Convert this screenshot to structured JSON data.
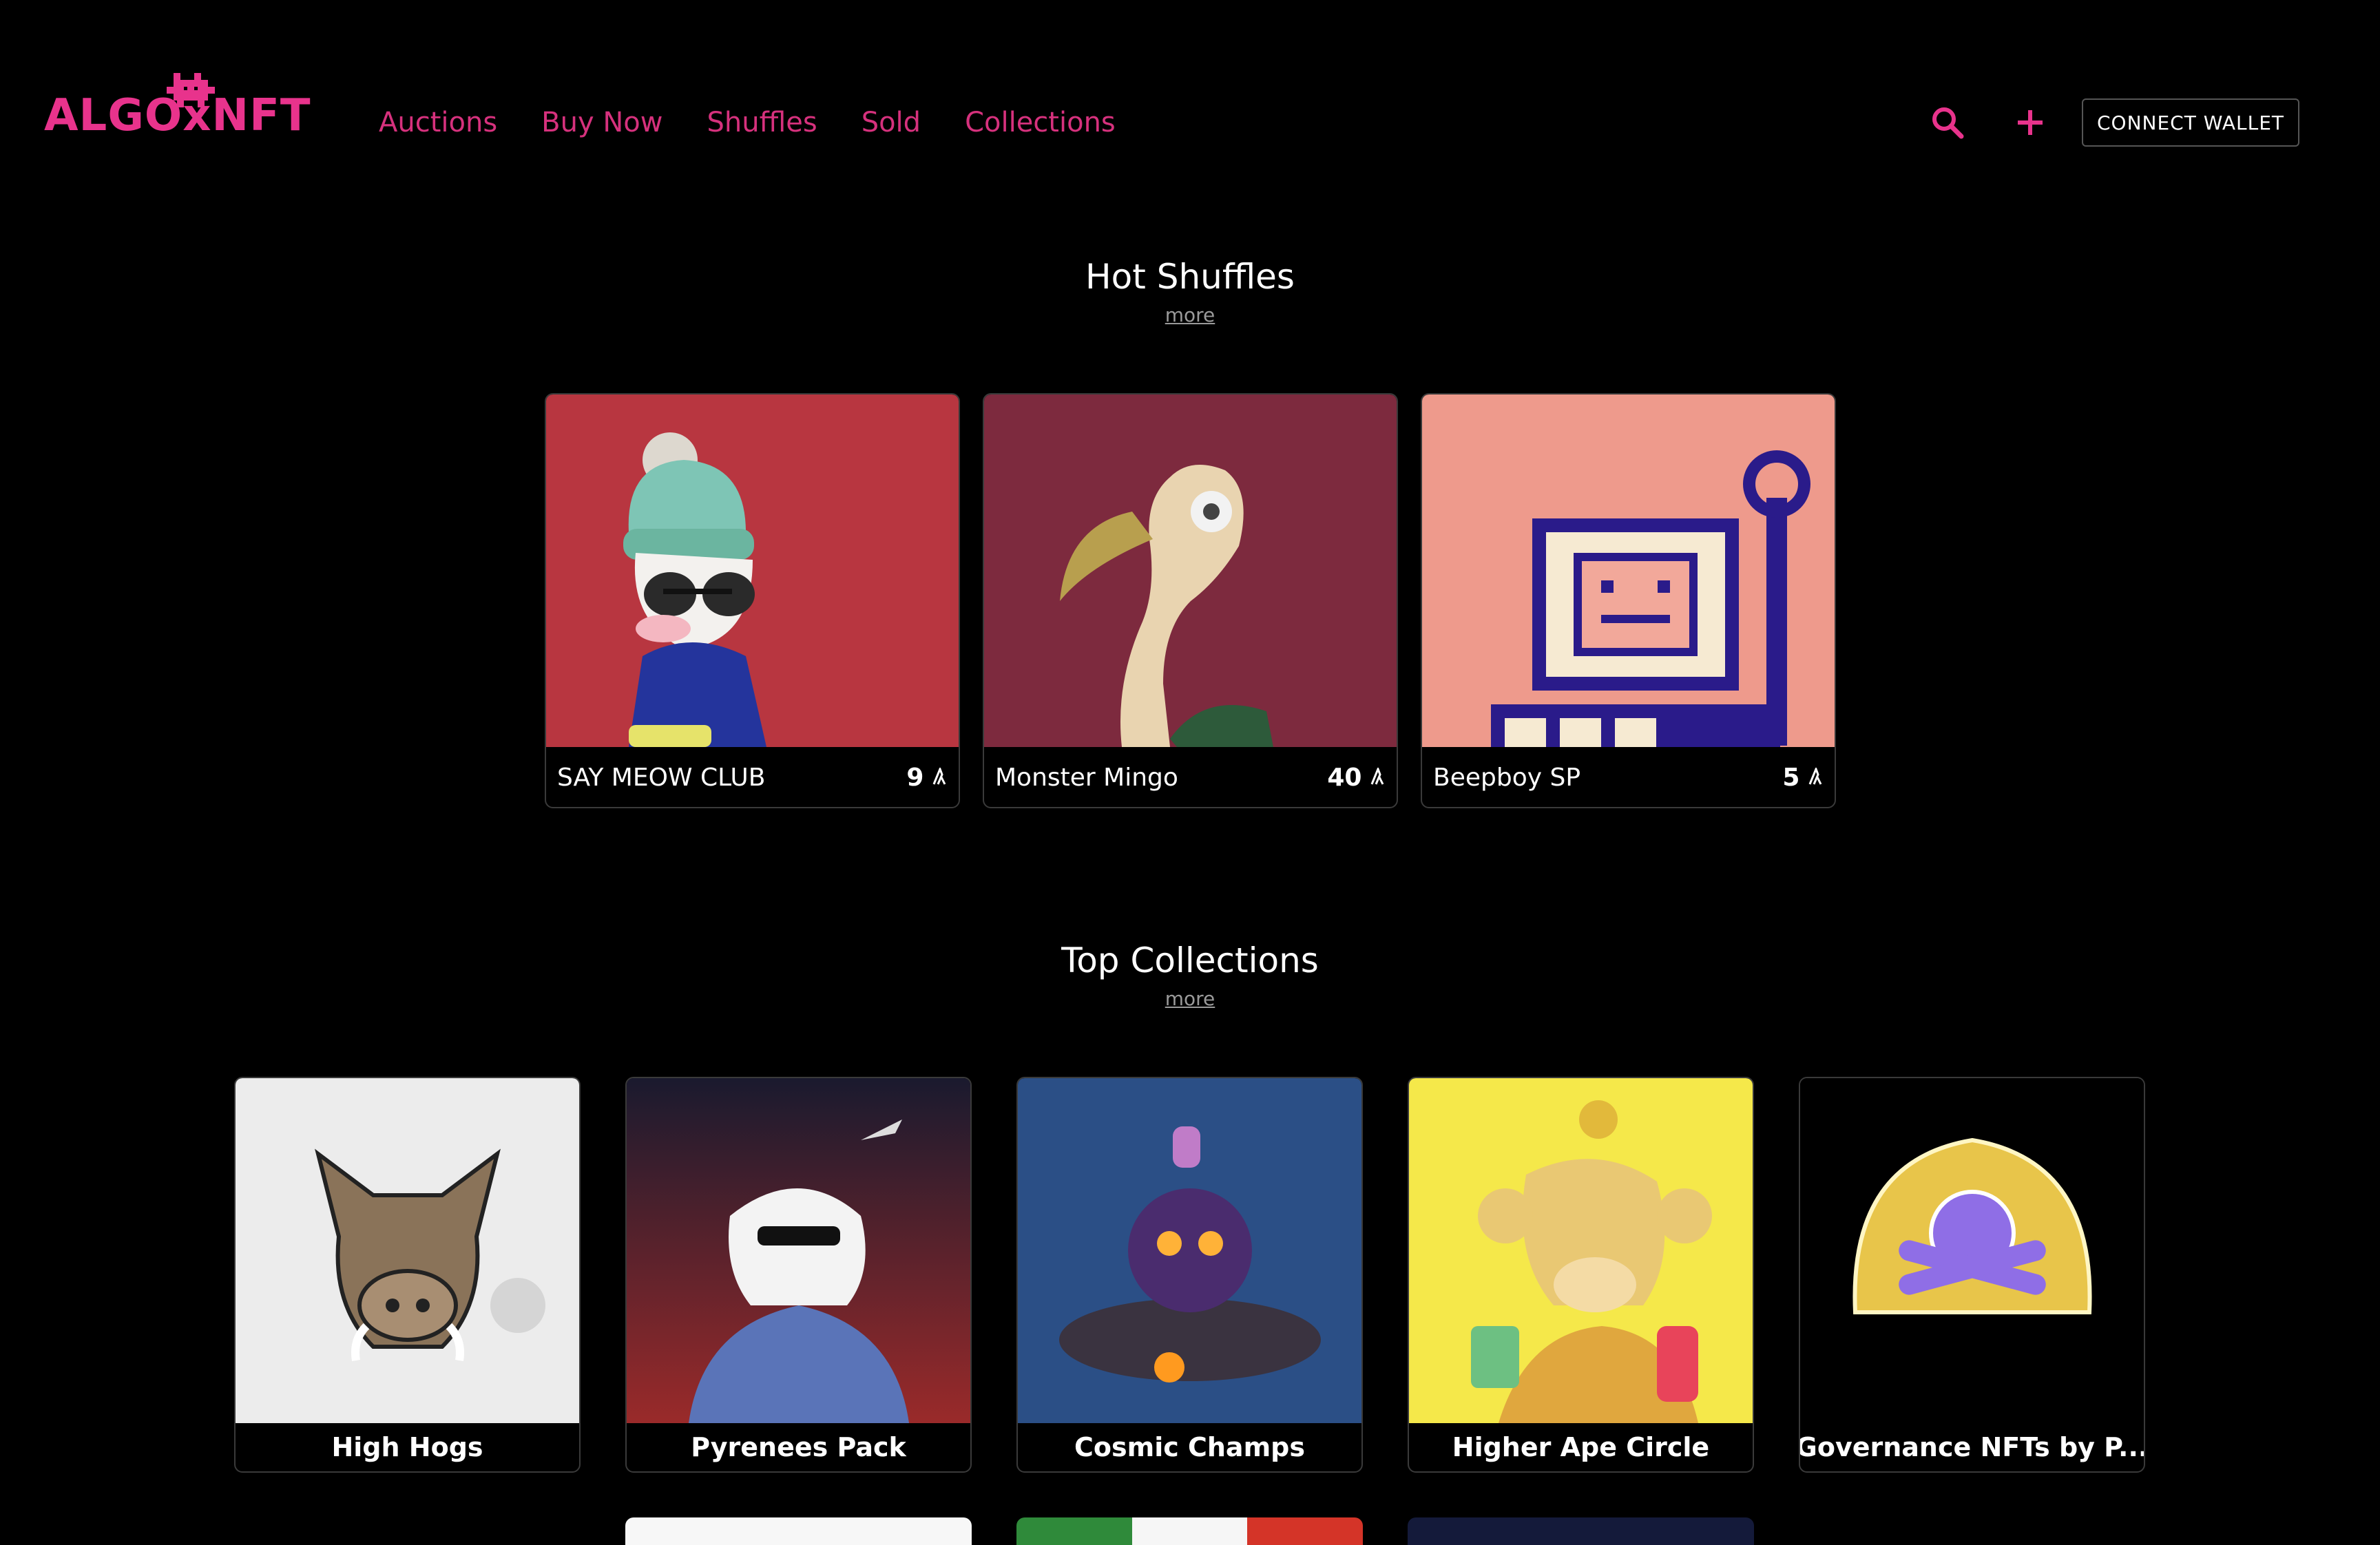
{
  "header": {
    "logo_text": "ALGOxNFT",
    "nav": [
      "Auctions",
      "Buy Now",
      "Shuffles",
      "Sold",
      "Collections"
    ],
    "search_icon": "search-icon",
    "add_icon": "plus-icon",
    "connect_label": "CONNECT WALLET"
  },
  "colors": {
    "brand": "#e8338c",
    "nav": "#d6317d",
    "background": "#000000"
  },
  "hot_shuffles": {
    "title": "Hot Shuffles",
    "more": "more",
    "items": [
      {
        "name": "SAY MEOW CLUB",
        "price": "9",
        "currency_icon": "algo-icon",
        "bg": "#b83640"
      },
      {
        "name": "Monster Mingo",
        "price": "40",
        "currency_icon": "algo-icon",
        "bg": "#7d2a3e"
      },
      {
        "name": "Beepboy SP",
        "price": "5",
        "currency_icon": "algo-icon",
        "bg": "#ee9a8c"
      }
    ]
  },
  "top_collections": {
    "title": "Top Collections",
    "more": "more",
    "items": [
      {
        "name": "High Hogs"
      },
      {
        "name": "Pyrenees Pack"
      },
      {
        "name": "Cosmic Champs"
      },
      {
        "name": "Higher Ape Circle"
      },
      {
        "name": "Governance NFTs by P..."
      }
    ]
  }
}
